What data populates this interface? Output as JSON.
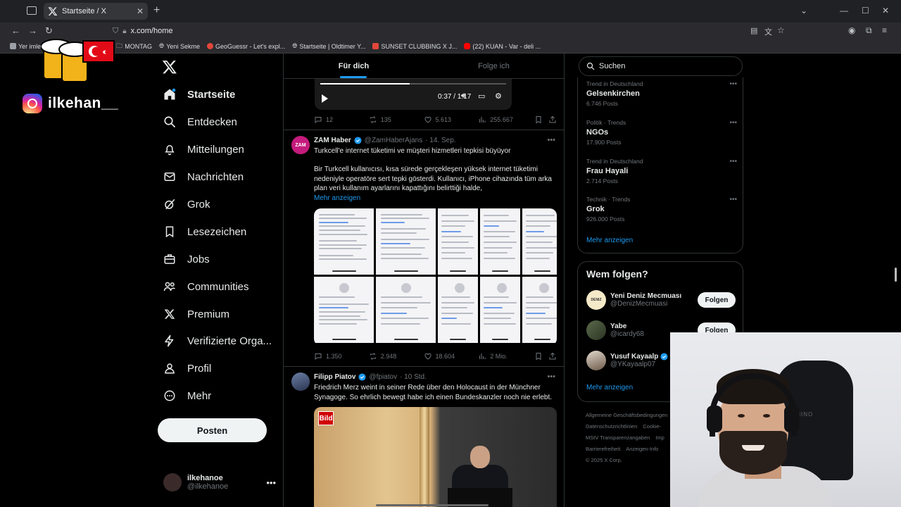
{
  "browser": {
    "tab_title": "Startseite / X",
    "url": "x.com/home",
    "bookmarks": [
      {
        "label": "Yer imleri",
        "color": "#9aa0a6"
      },
      {
        "label": "MONTAG",
        "color": "#9aa0a6"
      },
      {
        "label": "Yeni Sekme",
        "color": "#9aa0a6"
      },
      {
        "label": "GeoGuessr - Let's expl...",
        "color": "#e2463a"
      },
      {
        "label": "Startseite | Oldtimer Y...",
        "color": "#9aa0a6"
      },
      {
        "label": "SUNSET CLUBBING X J...",
        "color": "#e2463a"
      },
      {
        "label": "(22) KUAN - Var - deli ...",
        "color": "#ff0000"
      }
    ]
  },
  "overlay": {
    "instagram_handle": "ilkehan__"
  },
  "nav": {
    "items": [
      {
        "label": "Startseite",
        "icon": "home-icon"
      },
      {
        "label": "Entdecken",
        "icon": "search-icon"
      },
      {
        "label": "Mitteilungen",
        "icon": "bell-icon"
      },
      {
        "label": "Nachrichten",
        "icon": "mail-icon"
      },
      {
        "label": "Grok",
        "icon": "grok-icon"
      },
      {
        "label": "Lesezeichen",
        "icon": "bookmark-icon"
      },
      {
        "label": "Jobs",
        "icon": "briefcase-icon"
      },
      {
        "label": "Communities",
        "icon": "people-icon"
      },
      {
        "label": "Premium",
        "icon": "x-icon"
      },
      {
        "label": "Verifizierte Orga...",
        "icon": "lightning-icon"
      },
      {
        "label": "Profil",
        "icon": "person-icon"
      },
      {
        "label": "Mehr",
        "icon": "more-circle-icon"
      }
    ],
    "post_label": "Posten",
    "account": {
      "name": "ilkehanoe",
      "handle": "@ilkehanoe"
    }
  },
  "timeline": {
    "tabs": [
      "Für dich",
      "Folge ich"
    ],
    "video": {
      "time": "0:37 / 1:17",
      "progress": 0.48
    },
    "tweet0_actions": {
      "replies": "12",
      "reposts": "135",
      "likes": "5.613",
      "views": "255.667"
    },
    "tweet1": {
      "name": "ZAM Haber",
      "handle": "@ZamHaberAjans",
      "date": "· 14. Sep.",
      "title": "Turkcell'e internet tüketimi ve müşteri hizmetleri tepkisi büyüyor",
      "body": "Bir Turkcell kullanıcısı, kısa sürede gerçekleşen yüksek internet tüketimi nedeniyle operatöre sert tepki gösterdi. Kullanıcı, iPhone cihazında tüm arka plan veri kullanım ayarlarını kapattığını belirttiği halde,",
      "show_more": "Mehr anzeigen",
      "actions": {
        "replies": "1.350",
        "reposts": "2.948",
        "likes": "18.604",
        "views": "2 Mio."
      }
    },
    "tweet2": {
      "name": "Filipp Piatov",
      "handle": "@fpiatov",
      "date": "· 10 Std.",
      "body": "Friedrich Merz weint in seiner Rede über den Holocaust in der Münchner Synagoge. So ehrlich bewegt habe ich einen Bundeskanzler noch nie erlebt.",
      "image_logo": "Bild"
    }
  },
  "sidebar": {
    "search_placeholder": "Suchen",
    "trends": [
      {
        "category": "Trend in Deutschland",
        "title": "Gelsenkirchen",
        "count": "6.746 Posts"
      },
      {
        "category": "Politik · Trends",
        "title": "NGOs",
        "count": "17.900 Posts"
      },
      {
        "category": "Trend in Deutschland",
        "title": "Frau Hayali",
        "count": "2.714 Posts"
      },
      {
        "category": "Technik · Trends",
        "title": "Grok",
        "count": "926.000 Posts"
      }
    ],
    "trends_more": "Mehr anzeigen",
    "who_to_follow": {
      "title": "Wem folgen?",
      "accounts": [
        {
          "name": "Yeni Deniz Mecmuası",
          "handle": "@DenizMecmuasi",
          "button": "Folgen"
        },
        {
          "name": "Yabe",
          "handle": "@icardy68",
          "button": "Folgen"
        },
        {
          "name": "Yusuf Kayaalp",
          "handle": "@YKayaalp07",
          "button": ""
        }
      ],
      "more": "Mehr anzeigen"
    },
    "footer": {
      "line1a": "Allgemeine Geschäftsbedingungen",
      "line2a": "Datenschutzrichtlinien",
      "line2b": "Cookie-",
      "line3a": "MStV Transparenzangaben",
      "line3b": "Imp",
      "line4a": "Barrierefreiheit",
      "line4b": "Anzeigen-Info",
      "line5a": "© 2025 X Corp."
    }
  },
  "webcam": {
    "chair_logo": "XMINO"
  }
}
